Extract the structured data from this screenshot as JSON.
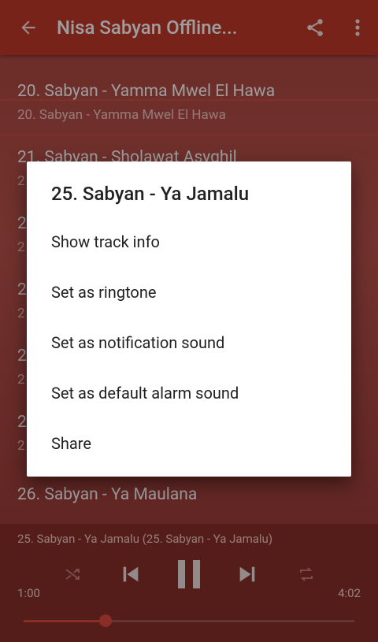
{
  "appbar": {
    "title": "Nisa Sabyan Offline..."
  },
  "list": [
    {
      "title": "20. Sabyan - Yamma Mwel El Hawa",
      "subtitle": "20. Sabyan - Yamma Mwel El Hawa"
    },
    {
      "title": "21. Sabyan - Sholawat Asyghil",
      "subtitle": "2"
    },
    {
      "title": "2",
      "subtitle": "2"
    },
    {
      "title": "2",
      "subtitle": "2"
    },
    {
      "title": "2",
      "subtitle": "2"
    },
    {
      "title": "2",
      "subtitle": "2"
    },
    {
      "title": "26. Sabyan - Ya Maulana",
      "subtitle": ""
    }
  ],
  "dialog": {
    "title": "25. Sabyan - Ya Jamalu",
    "items": [
      "Show track info",
      "Set as ringtone",
      "Set as notification sound",
      "Set as default alarm sound",
      "Share"
    ]
  },
  "player": {
    "now_playing": "25. Sabyan - Ya Jamalu (25. Sabyan - Ya Jamalu)",
    "current_time": "1:00",
    "duration": "4:02",
    "progress": 0.248
  },
  "colors": {
    "appbar": "#c0392b",
    "accent": "#e04a3f",
    "player_bg": "#8a2f2a"
  }
}
